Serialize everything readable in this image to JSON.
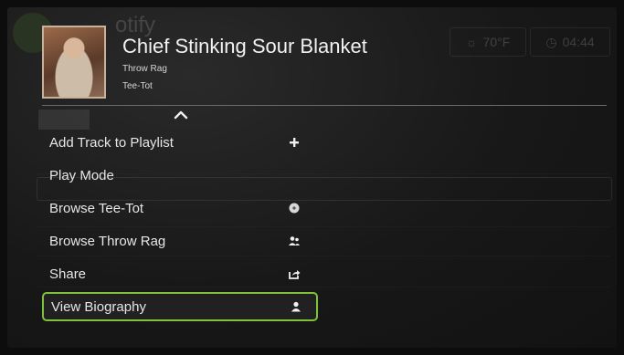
{
  "background": {
    "app_title": "otify",
    "weather": "70°F",
    "time": "04:44",
    "rows": [
      "",
      "",
      "",
      "",
      ""
    ]
  },
  "header": {
    "track_title": "Chief Stinking Sour Blanket",
    "album": "Throw Rag",
    "artist": "Tee-Tot"
  },
  "menu": {
    "items": [
      {
        "label": "Add Track to Playlist",
        "icon": "plus-icon"
      },
      {
        "label": "Play Mode",
        "icon": ""
      },
      {
        "label": "Browse Tee-Tot",
        "icon": "disc-icon"
      },
      {
        "label": "Browse Throw Rag",
        "icon": "people-icon"
      },
      {
        "label": "Share",
        "icon": "share-icon"
      },
      {
        "label": "View Biography",
        "icon": "person-icon"
      }
    ],
    "selected_index": 5
  },
  "colors": {
    "selection_border": "#7ec23c",
    "background": "#181818",
    "text": "#e6e6e6"
  }
}
